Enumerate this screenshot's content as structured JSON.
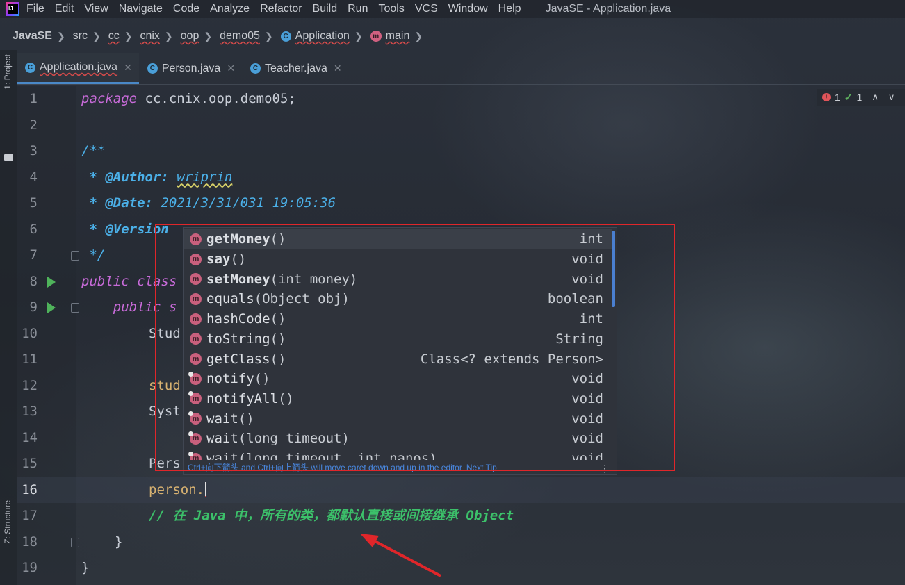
{
  "menu": {
    "items": [
      "File",
      "Edit",
      "View",
      "Navigate",
      "Code",
      "Analyze",
      "Refactor",
      "Build",
      "Run",
      "Tools",
      "VCS",
      "Window",
      "Help"
    ],
    "window_title": "JavaSE - Application.java"
  },
  "breadcrumbs": [
    "JavaSE",
    "src",
    "cc",
    "cnix",
    "oop",
    "demo05",
    "Application",
    "main"
  ],
  "tool_windows": {
    "project": "1: Project",
    "structure": "Z: Structure"
  },
  "tabs": [
    {
      "label": "Application.java",
      "active": true
    },
    {
      "label": "Person.java",
      "active": false
    },
    {
      "label": "Teacher.java",
      "active": false
    }
  ],
  "inspections": {
    "errors": "1",
    "ok": "1"
  },
  "editor": {
    "line_numbers": [
      "1",
      "2",
      "3",
      "4",
      "5",
      "6",
      "7",
      "8",
      "9",
      "10",
      "11",
      "12",
      "13",
      "14",
      "15",
      "16",
      "17",
      "18",
      "19"
    ],
    "current_line": "16",
    "code": {
      "l1_kw": "package",
      "l1_rest": " cc.cnix.oop.demo05;",
      "l3": "/**",
      "l4_tag": " * @Author: ",
      "l4_val": "wriprin",
      "l5_tag": " * @Date: ",
      "l5_val": "2021/3/31/031 19:05:36",
      "l6_tag": " * @Version",
      "l7": " */",
      "l8": "public class",
      "l9": "    public s",
      "l10": "Stud",
      "l12": "stud",
      "l13": "Syst",
      "l15": "Pers",
      "l16": "person.",
      "l17": "// 在 Java 中，所有的类，都默认直接或间接继承 Object",
      "l18": "}",
      "l19": "}"
    }
  },
  "completion": {
    "items": [
      {
        "name": "getMoney",
        "args": "()",
        "type": "int",
        "bold": true,
        "native": false
      },
      {
        "name": "say",
        "args": "()",
        "type": "void",
        "bold": true,
        "native": false
      },
      {
        "name": "setMoney",
        "args": "(int money)",
        "type": "void",
        "bold": true,
        "native": false
      },
      {
        "name": "equals",
        "args": "(Object obj)",
        "type": "boolean",
        "bold": false,
        "native": false
      },
      {
        "name": "hashCode",
        "args": "()",
        "type": "int",
        "bold": false,
        "native": false
      },
      {
        "name": "toString",
        "args": "()",
        "type": "String",
        "bold": false,
        "native": false
      },
      {
        "name": "getClass",
        "args": "()",
        "type": "Class<? extends Person>",
        "bold": false,
        "native": false
      },
      {
        "name": "notify",
        "args": "()",
        "type": "void",
        "bold": false,
        "native": true
      },
      {
        "name": "notifyAll",
        "args": "()",
        "type": "void",
        "bold": false,
        "native": true
      },
      {
        "name": "wait",
        "args": "()",
        "type": "void",
        "bold": false,
        "native": true
      },
      {
        "name": "wait",
        "args": "(long timeout)",
        "type": "void",
        "bold": false,
        "native": true
      },
      {
        "name": "wait",
        "args": "(long timeout, int nanos)",
        "type": "void",
        "bold": false,
        "native": true
      }
    ],
    "footer_hint": "Ctrl+向下箭头 and Ctrl+向上箭头 will move caret down and up in the editor",
    "footer_link": "Next Tip",
    "more": "⋮"
  },
  "colors": {
    "accent": "#4a88c7",
    "annotation_red": "#e0262a",
    "run_green": "#4fb35b",
    "comment_green": "#3cc06a"
  }
}
